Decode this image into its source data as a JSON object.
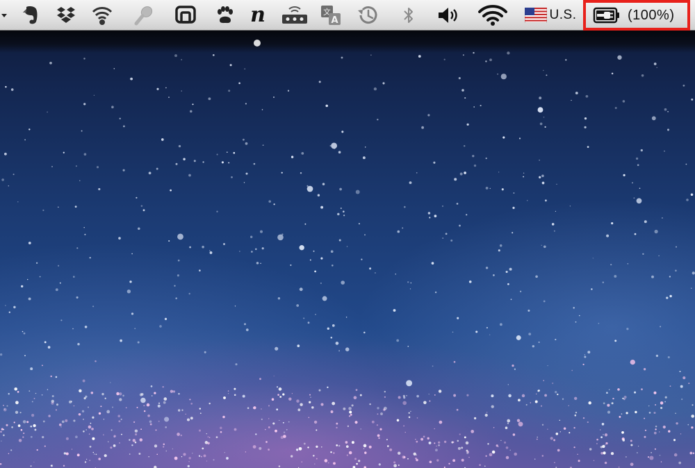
{
  "desktop": {
    "wallpaper": "galaxy"
  },
  "menubar": {
    "icons": [
      {
        "name": "overflow-arrow-icon"
      },
      {
        "name": "evernote-icon"
      },
      {
        "name": "dropbox-icon"
      },
      {
        "name": "wifi-hotspot-icon"
      },
      {
        "name": "microphone-icon"
      },
      {
        "name": "display-icon"
      },
      {
        "name": "paw-icon"
      },
      {
        "name": "n-app-icon"
      },
      {
        "name": "network-tool-icon"
      },
      {
        "name": "translate-icon"
      },
      {
        "name": "time-machine-icon"
      },
      {
        "name": "bluetooth-icon"
      },
      {
        "name": "volume-icon"
      },
      {
        "name": "wifi-icon"
      }
    ],
    "n_app_letter": "n",
    "input_source": {
      "flag": "us-flag-icon",
      "label": "U.S."
    },
    "battery": {
      "label": "(100%)",
      "charge_fraction": 1.0,
      "status": "charging",
      "highlight_color": "#e8211b"
    }
  }
}
